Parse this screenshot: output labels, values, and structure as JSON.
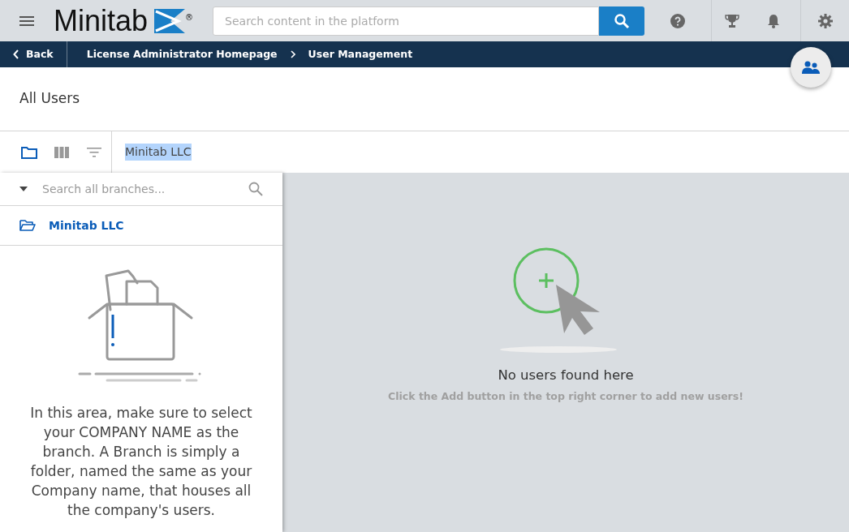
{
  "header": {
    "logo": {
      "text": "Minitab",
      "mark": "®"
    },
    "search": {
      "placeholder": "Search content in the platform"
    }
  },
  "breadcrumb": {
    "back": "Back",
    "items": [
      "License Administrator Homepage",
      "User Management"
    ]
  },
  "page_title": "All Users",
  "toolbar": {
    "views": [
      {
        "kind": "folder",
        "selected": true
      },
      {
        "kind": "columns",
        "selected": false
      },
      {
        "kind": "filter",
        "selected": false
      }
    ],
    "path": {
      "text": "Minitab LLC",
      "highlighted": true
    }
  },
  "branches": {
    "search": {
      "placeholder": "Search all branches..."
    },
    "items": [
      {
        "label": "Minitab LLC",
        "selected": true
      }
    ],
    "note": "In this area, make sure to select your COMPANY NAME as the branch. A Branch is simply a folder, named the same as your Company name, that houses all the company's users."
  },
  "empty_state": {
    "title": "No users found here",
    "hint": "Click the Add button in the top right corner to add new users!"
  }
}
